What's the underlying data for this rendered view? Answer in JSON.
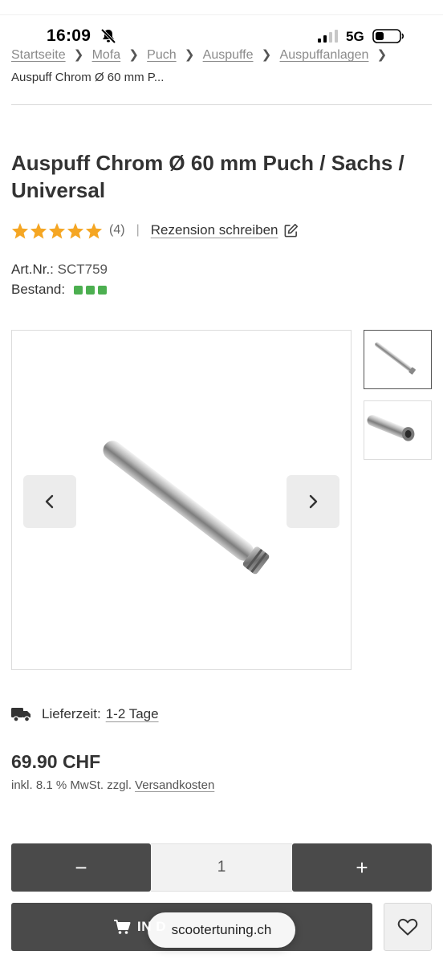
{
  "status": {
    "time": "16:09",
    "network": "5G"
  },
  "breadcrumb": {
    "items": [
      "Startseite",
      "Mofa",
      "Puch",
      "Auspuffe",
      "Auspuffanlagen"
    ],
    "current": "Auspuff Chrom Ø 60 mm P..."
  },
  "product": {
    "title": "Auspuff Chrom Ø 60 mm Puch / Sachs / Universal",
    "rating_stars": 5,
    "review_count": "(4)",
    "separator": "|",
    "write_review": "Rezension schreiben",
    "art_label": "Art.Nr.:",
    "art_number": "SCT759",
    "stock_label": "Bestand:",
    "delivery_label": "Lieferzeit:",
    "delivery_value": "1-2 Tage",
    "price": "69.90 CHF",
    "tax_note": "inkl. 8.1 % MwSt. zzgl.",
    "shipping_link": "Versandkosten"
  },
  "purchase": {
    "minus": "−",
    "quantity": "1",
    "plus": "+",
    "cart_label": "IN D",
    "url": "scootertuning.ch"
  },
  "colors": {
    "dark_button": "#4a4a4a",
    "star": "#f5a623",
    "stock_green": "#4caf50"
  },
  "icons": {
    "chevron": "chevron-right-icon",
    "pencil": "edit-icon",
    "truck": "truck-icon",
    "cart": "cart-icon",
    "heart": "heart-icon"
  }
}
